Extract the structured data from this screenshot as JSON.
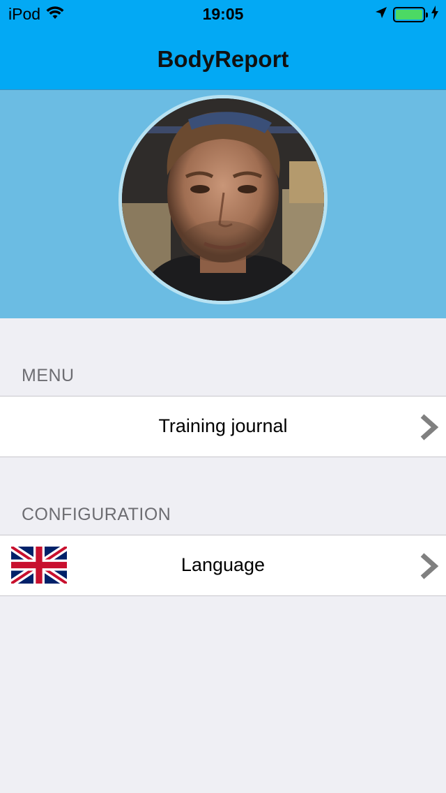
{
  "status_bar": {
    "carrier": "iPod",
    "time": "19:05",
    "battery_color": "#4cd964"
  },
  "nav": {
    "title": "BodyReport",
    "bar_color": "#03a9f4"
  },
  "profile": {
    "avatar_icon": "user-avatar-photo",
    "header_color": "#6bbce3"
  },
  "menu": {
    "header": "MENU",
    "items": [
      {
        "label": "Training journal",
        "icon": "chevron-right-icon"
      }
    ]
  },
  "configuration": {
    "header": "CONFIGURATION",
    "items": [
      {
        "label": "Language",
        "icon": "uk-flag-icon"
      }
    ]
  }
}
